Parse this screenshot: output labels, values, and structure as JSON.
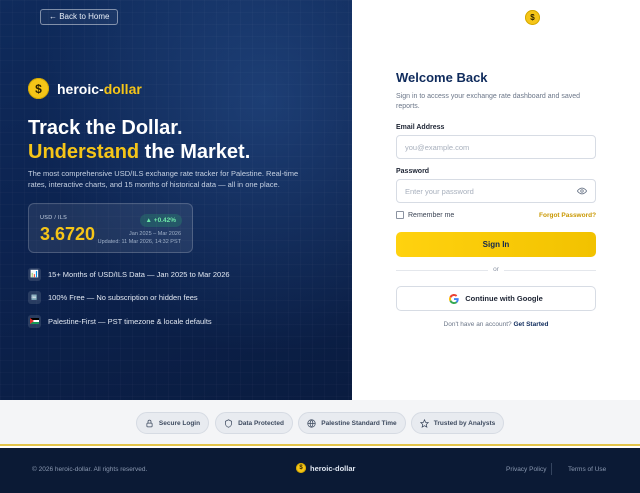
{
  "hero": {
    "back_label": "← Back to Home",
    "brand_coin": "$",
    "brand_first": "heroic-",
    "brand_second": "dollar",
    "headline_line1": "Track the Dollar.",
    "headline_line2_accent": "Understand",
    "headline_line2_rest": " the Market.",
    "description": "The most comprehensive USD/ILS exchange rate tracker for Palestine. Real-time rates, interactive charts, and 15 months of historical data — all in one place.",
    "rate_card": {
      "label": "USD / ILS",
      "value": "3.6720",
      "change": "▲ +0.42%",
      "range": "Jan 2025 – Mar 2026",
      "updated": "Updated: 11 Mar 2026, 14:32 PST"
    },
    "features": [
      {
        "icon": "chart-icon",
        "glyph": "📊",
        "text": "15+ Months of USD/ILS Data — Jan 2025 to Mar 2026"
      },
      {
        "icon": "free-icon",
        "glyph": "🆓",
        "text": "100% Free — No subscription or hidden fees"
      },
      {
        "icon": "flag-icon",
        "glyph": "🇵🇸",
        "text": "Palestine-First — PST timezone & locale defaults"
      }
    ]
  },
  "login": {
    "top_coin": "$",
    "title": "Welcome Back",
    "subtitle": "Sign in to access your exchange rate dashboard and saved reports.",
    "email_label": "Email Address",
    "email_placeholder": "you@example.com",
    "password_label": "Password",
    "password_placeholder": "Enter your password",
    "remember_label": "Remember me",
    "forgot_label": "Forgot Password?",
    "signin_label": "Sign In",
    "or_label": "or",
    "google_label": "Continue with Google",
    "no_account_text": "Don't have an account?",
    "get_started_label": "Get Started"
  },
  "trust": [
    {
      "icon": "lock-icon",
      "label": "Secure Login"
    },
    {
      "icon": "shield-icon",
      "label": "Data Protected"
    },
    {
      "icon": "globe-icon",
      "label": "Palestine Standard Time"
    },
    {
      "icon": "star-icon",
      "label": "Trusted by Analysts"
    }
  ],
  "footer": {
    "copyright": "© 2026 heroic-dollar. All rights reserved.",
    "brand": "heroic-dollar",
    "brand_coin": "$",
    "privacy": "Privacy Policy",
    "terms": "Terms of Use"
  },
  "colors": {
    "navy": "#0f2b5c",
    "gold": "#f5c518",
    "green": "#6ee7a8",
    "footer": "#0b1a35"
  }
}
